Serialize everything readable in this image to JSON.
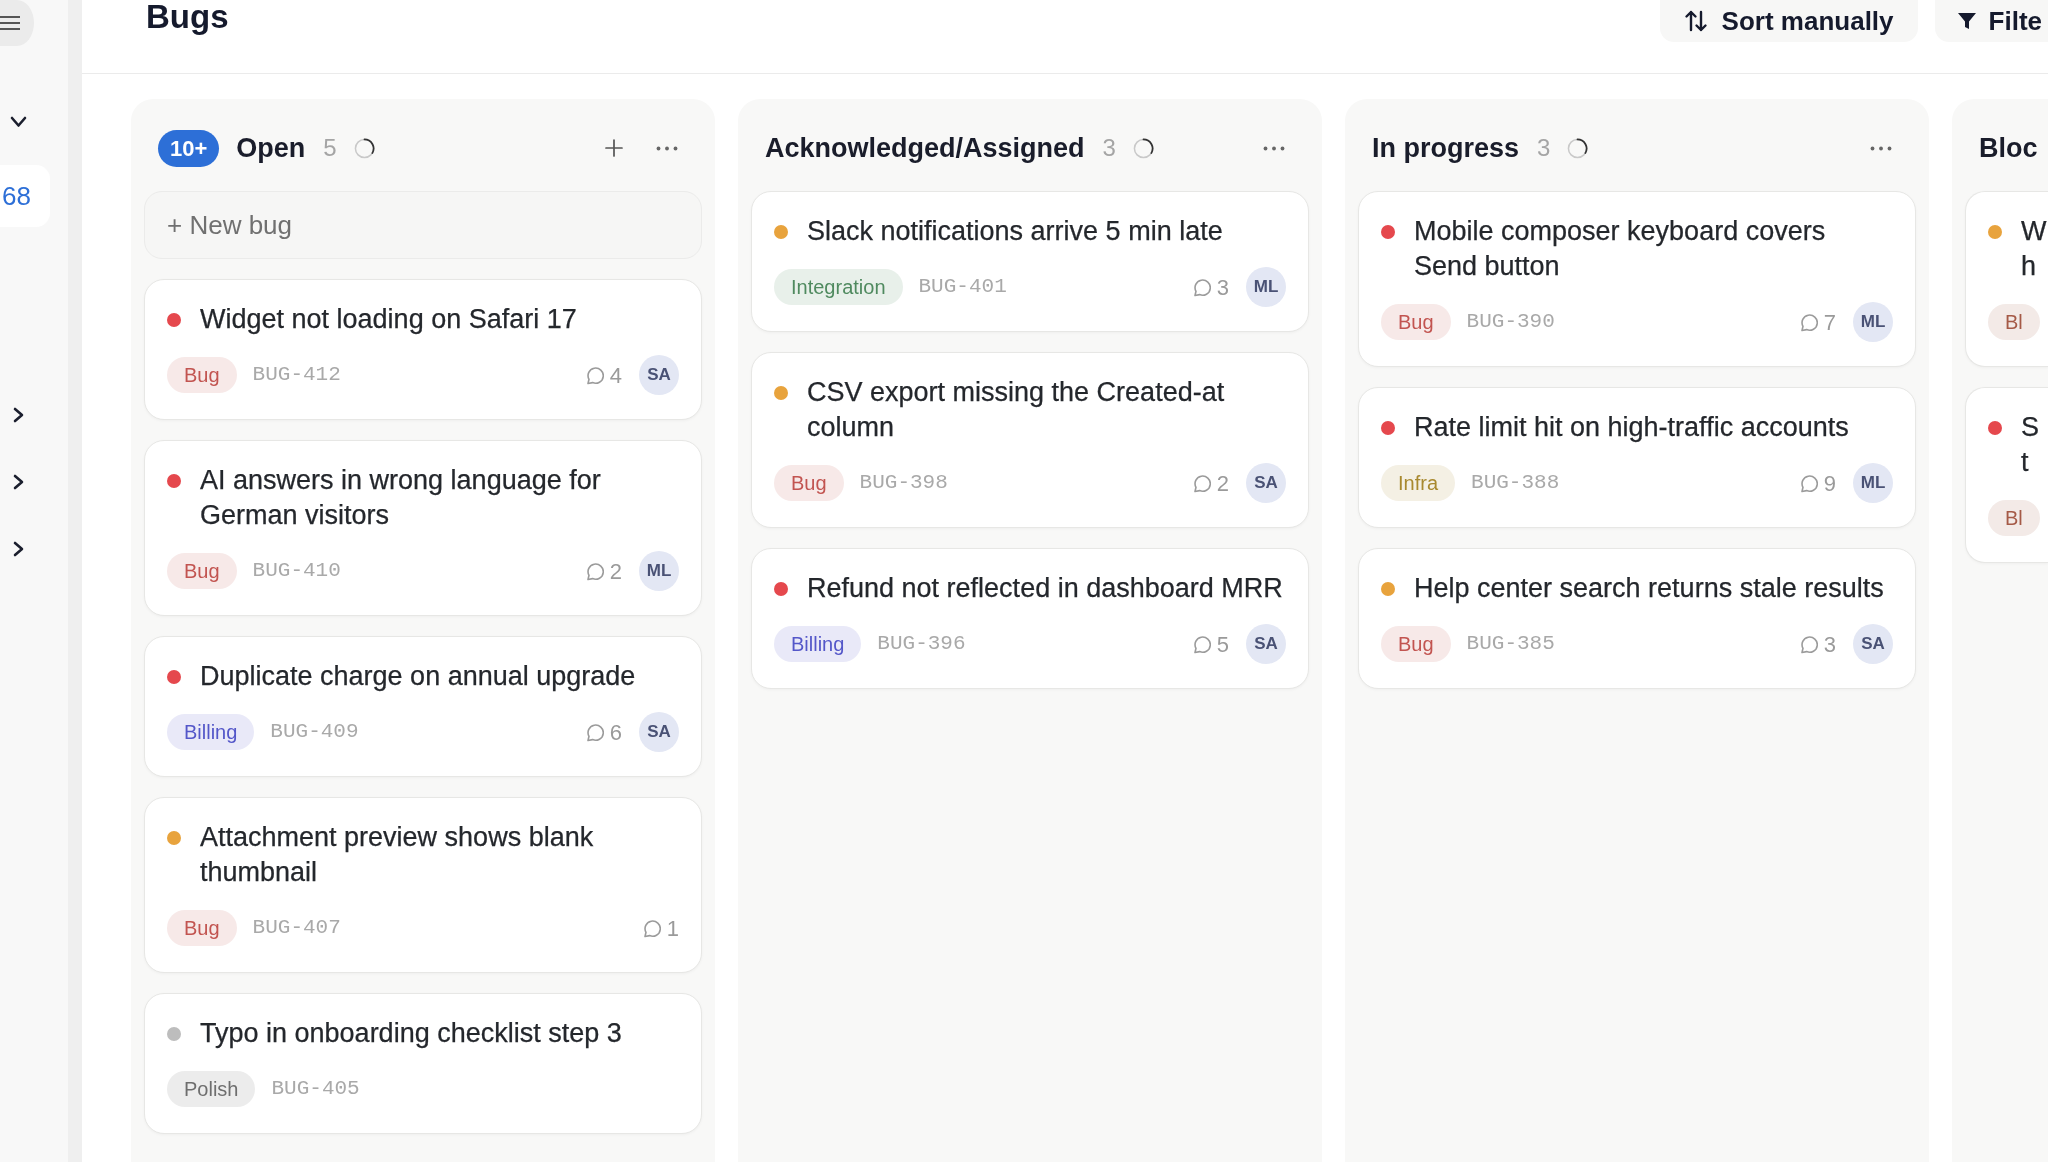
{
  "sidebar": {
    "items": [
      {
        "kind": "toggle",
        "expanded": true
      },
      {
        "kind": "count",
        "text": "68"
      },
      {
        "kind": "toggle",
        "expanded": false
      },
      {
        "kind": "toggle",
        "expanded": false
      },
      {
        "kind": "toggle",
        "expanded": false
      }
    ]
  },
  "header": {
    "title": "Bugs",
    "buttons": [
      {
        "kind": "sort",
        "label": "Sort manually"
      },
      {
        "kind": "filter",
        "label": "Filte"
      }
    ]
  },
  "columns": [
    {
      "title": "Open",
      "badge": "10+",
      "count": "5",
      "loading": true,
      "add_button": true,
      "menu": true,
      "new_item": "+ New bug",
      "cards": [
        {
          "title": "Widget not loading on Safari 17",
          "color": "#e5484d",
          "tag": {
            "text": "Bug",
            "color": "#c25450"
          },
          "id": "BUG-412",
          "comments": "4",
          "assignee": "SA"
        },
        {
          "title": "AI answers in wrong language for German visitors",
          "color": "#e5484d",
          "tag": {
            "text": "Bug",
            "color": "#c25450"
          },
          "id": "BUG-410",
          "comments": "2",
          "assignee": "ML"
        },
        {
          "title": "Duplicate charge on annual upgrade",
          "color": "#e5484d",
          "tag": {
            "text": "Billing",
            "color": "#5457c9"
          },
          "id": "BUG-409",
          "comments": "6",
          "assignee": "SA"
        },
        {
          "title": "Attachment preview shows blank thumbnail",
          "color": "#e8a33d",
          "tag": {
            "text": "Bug",
            "color": "#c25450"
          },
          "id": "BUG-407",
          "comments": "1"
        },
        {
          "title": "Typo in onboarding checklist step 3",
          "color": "#bdbdbd",
          "tag": {
            "text": "Polish",
            "color": "#6e6e6e"
          },
          "id": "BUG-405"
        }
      ]
    },
    {
      "title": "Acknowledged/Assigned",
      "count": "3",
      "loading": true,
      "add_button": false,
      "menu": true,
      "cards": [
        {
          "title": "Slack notifications arrive 5 min late",
          "color": "#e8a33d",
          "tag": {
            "text": "Integration",
            "color": "#4f8a5f"
          },
          "id": "BUG-401",
          "comments": "3",
          "assignee": "ML"
        },
        {
          "title": "CSV export missing the Created-at column",
          "color": "#e8a33d",
          "tag": {
            "text": "Bug",
            "color": "#c25450"
          },
          "id": "BUG-398",
          "comments": "2",
          "assignee": "SA"
        },
        {
          "title": "Refund not reflected in dashboard MRR",
          "color": "#e5484d",
          "tag": {
            "text": "Billing",
            "color": "#5457c9"
          },
          "id": "BUG-396",
          "comments": "5",
          "assignee": "SA"
        }
      ]
    },
    {
      "title": "In progress",
      "count": "3",
      "loading": true,
      "add_button": false,
      "menu": true,
      "cards": [
        {
          "title": "Mobile composer keyboard covers Send button",
          "color": "#e5484d",
          "tag": {
            "text": "Bug",
            "color": "#c25450"
          },
          "id": "BUG-390",
          "comments": "7",
          "assignee": "ML"
        },
        {
          "title": "Rate limit hit on high-traffic accounts",
          "color": "#e5484d",
          "tag": {
            "text": "Infra",
            "color": "#a8892f"
          },
          "id": "BUG-388",
          "comments": "9",
          "assignee": "ML"
        },
        {
          "title": "Help center search returns stale results",
          "color": "#e8a33d",
          "tag": {
            "text": "Bug",
            "color": "#c25450"
          },
          "id": "BUG-385",
          "comments": "3",
          "assignee": "SA"
        }
      ]
    },
    {
      "title": "Bloc",
      "cards": [
        {
          "title": "W h",
          "color": "#e8a33d",
          "tag": {
            "text": "Bl",
            "color": "#a55a47"
          }
        },
        {
          "title": "S t",
          "color": "#e5484d",
          "tag": {
            "text": "Bl",
            "color": "#a55a47"
          }
        }
      ]
    }
  ]
}
